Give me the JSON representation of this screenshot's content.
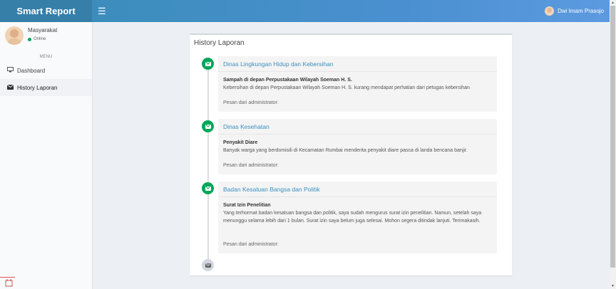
{
  "header": {
    "brand": "Smart Report",
    "menu_icon": "bars-icon",
    "user_name": "Dwi Imam Prasojo"
  },
  "sidebar": {
    "user": {
      "name": "Masyarakat",
      "status": "Online"
    },
    "menu_header": "MENU",
    "items": [
      {
        "label": "Dashboard",
        "icon": "desktop-icon"
      },
      {
        "label": "History Laporan",
        "icon": "envelope-icon",
        "active": true
      }
    ]
  },
  "main": {
    "title": "History Laporan",
    "timeline": [
      {
        "agency": "Dinas Lingkungan Hidup dan Kebersihan",
        "subject": "Sampah di depan Perpustakaan Wilayah Soeman H. S.",
        "body": "Kebersihan di depan Perpustakaan Wilayah Soeman H. S. kurang mendapat perhatian dari petugas kebersihan",
        "footer": "Pesan dari administrator:"
      },
      {
        "agency": "Dinas Kesehatan",
        "subject": "Penyakit Diare",
        "body": "Banyak warga yang berdomisili di Kecamatan Rumbai menderita penyakit diare pasca di landa bencana banjir.",
        "footer": "Pesan dari administrator:"
      },
      {
        "agency": "Badan Kesatuan Bangsa dan Politik",
        "subject": "Surat Izin Penelitian",
        "body": "Yang terhormat badan kesatuan bangsa dan politik, saya sudah mengurus surat izin penelitian. Namun, setelah saya menunggu selama lebih dari 1 bulan. Surat izin saya belum juga selesai. Mohon segera ditindak lanjuti. Terimakasih.",
        "footer": "Pesan dari administrator:"
      }
    ]
  },
  "colors": {
    "brand": "#367fa9",
    "navbar": "#3c8dbc",
    "timeline_icon": "#00a65a",
    "link": "#3c8dbc"
  }
}
